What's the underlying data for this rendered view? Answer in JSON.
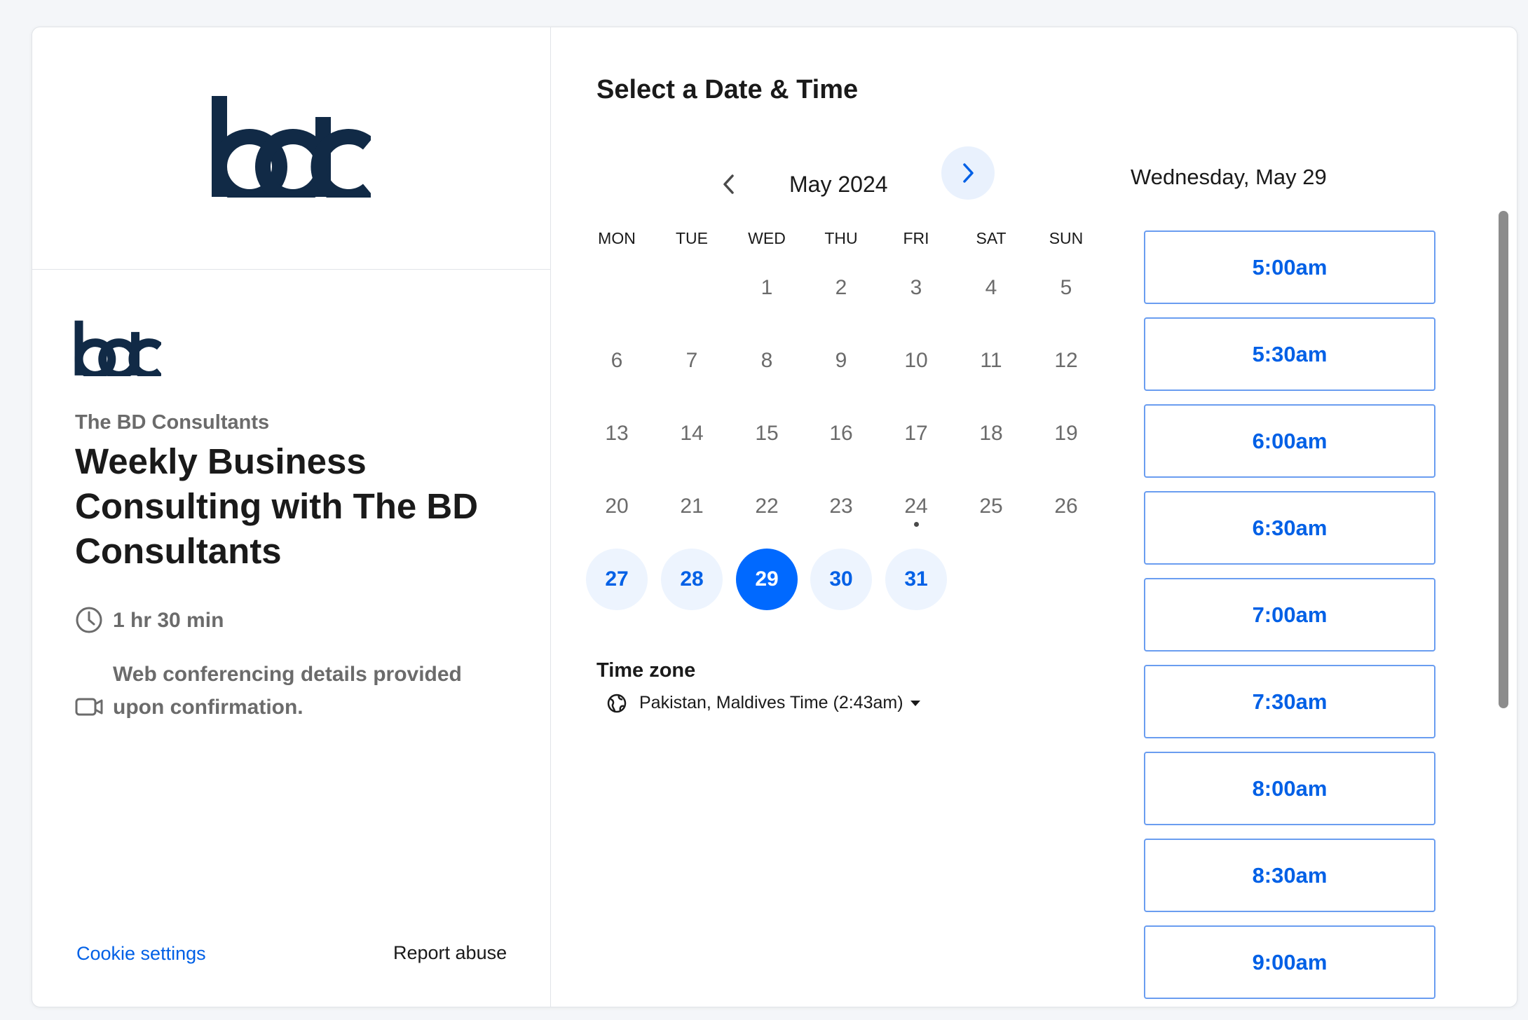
{
  "brand": {
    "logo_icon": "bdc-logo",
    "accent_color": "#0069ff"
  },
  "left_panel": {
    "organization": "The BD Consultants",
    "event_title": "Weekly Business Consulting with The BD Consultants",
    "duration": "1 hr 30 min",
    "conferencing": "Web conferencing details provided upon confirmation.",
    "footer": {
      "cookie_settings": "Cookie settings",
      "report_abuse": "Report abuse"
    }
  },
  "calendar": {
    "heading": "Select a Date & Time",
    "month_label": "May 2024",
    "weekdays": [
      "MON",
      "TUE",
      "WED",
      "THU",
      "FRI",
      "SAT",
      "SUN"
    ],
    "days": [
      "1",
      "2",
      "3",
      "4",
      "5",
      "6",
      "7",
      "8",
      "9",
      "10",
      "11",
      "12",
      "13",
      "14",
      "15",
      "16",
      "17",
      "18",
      "19",
      "20",
      "21",
      "22",
      "23",
      "24",
      "25",
      "26",
      "27",
      "28",
      "29",
      "30",
      "31"
    ],
    "first_weekday_index": 2,
    "available_days": [
      "27",
      "28",
      "30",
      "31"
    ],
    "selected_day": "29",
    "today": "24",
    "timezone_label": "Time zone",
    "timezone_value": "Pakistan, Maldives Time (2:43am)"
  },
  "time_slots": {
    "date_heading": "Wednesday, May 29",
    "slots": [
      "5:00am",
      "5:30am",
      "6:00am",
      "6:30am",
      "7:00am",
      "7:30am",
      "8:00am",
      "8:30am",
      "9:00am"
    ]
  }
}
